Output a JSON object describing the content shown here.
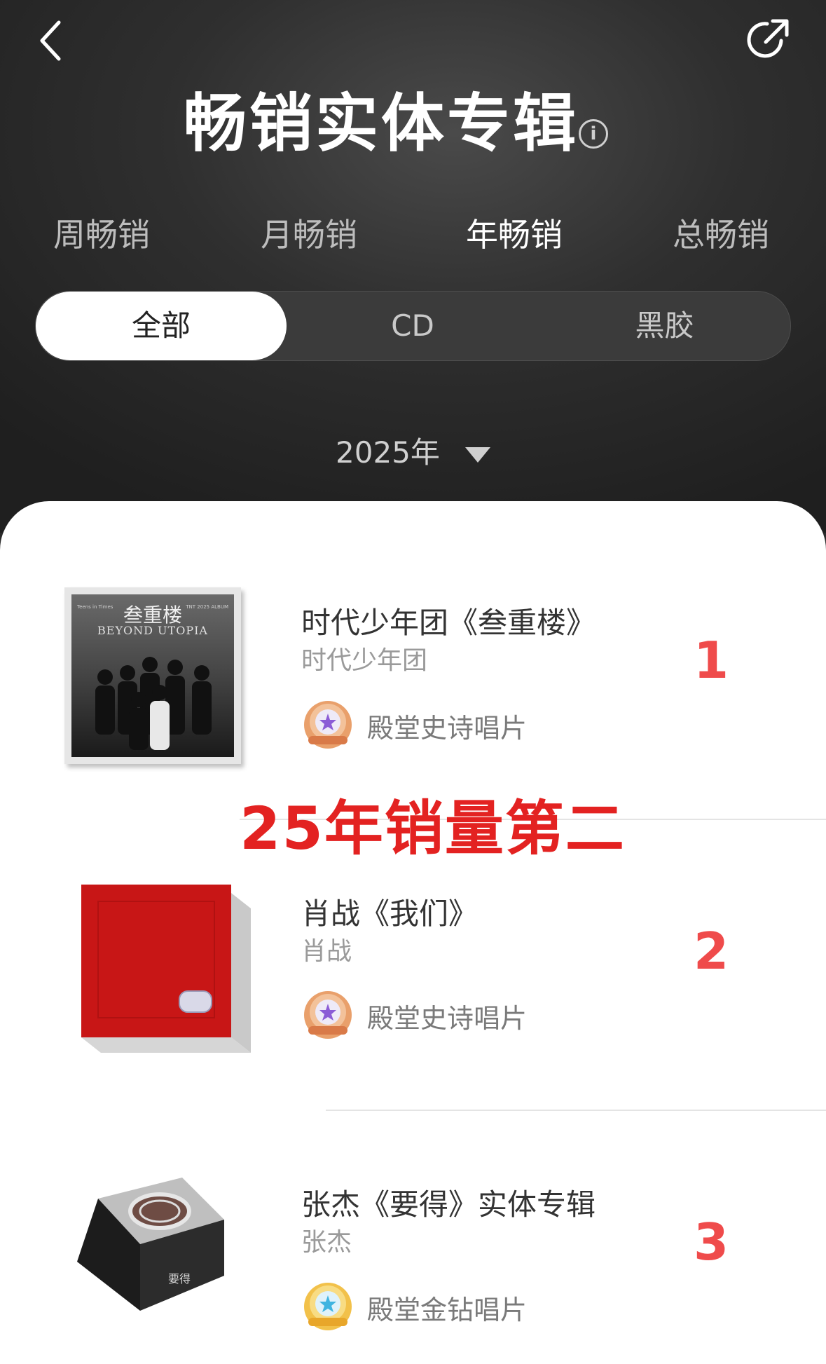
{
  "header": {
    "title": "畅销实体专辑",
    "info_icon": "i"
  },
  "periods": [
    "周畅销",
    "月畅销",
    "年畅销",
    "总畅销"
  ],
  "active_period": "年畅销",
  "formats": [
    "全部",
    "CD",
    "黑胶"
  ],
  "active_format": "全部",
  "year_selector": "2025年",
  "annotation": "25年销量第二",
  "albums": [
    {
      "title": "时代少年团《叁重楼》",
      "artist": "时代少年团",
      "badge": "殿堂史诗唱片",
      "badge_icon": "epic-record-badge-icon",
      "rank": "1",
      "cover_text": {
        "top": "叁重楼",
        "sub": "BEYOND UTOPIA",
        "left_small": "Teens in Times",
        "right_small": "TNT 2025 ALBUM"
      }
    },
    {
      "title": "肖战《我们》",
      "artist": "肖战",
      "badge": "殿堂史诗唱片",
      "badge_icon": "epic-record-badge-icon",
      "rank": "2"
    },
    {
      "title": "张杰《要得》实体专辑",
      "artist": "张杰",
      "badge": "殿堂金钻唱片",
      "badge_icon": "gold-diamond-record-badge-icon",
      "rank": "3",
      "cover_text": {
        "spine": "要得"
      }
    }
  ],
  "colors": {
    "rank": "#ef4b4b",
    "annotation": "#e32221",
    "header_bg": "#2f2f2f"
  }
}
